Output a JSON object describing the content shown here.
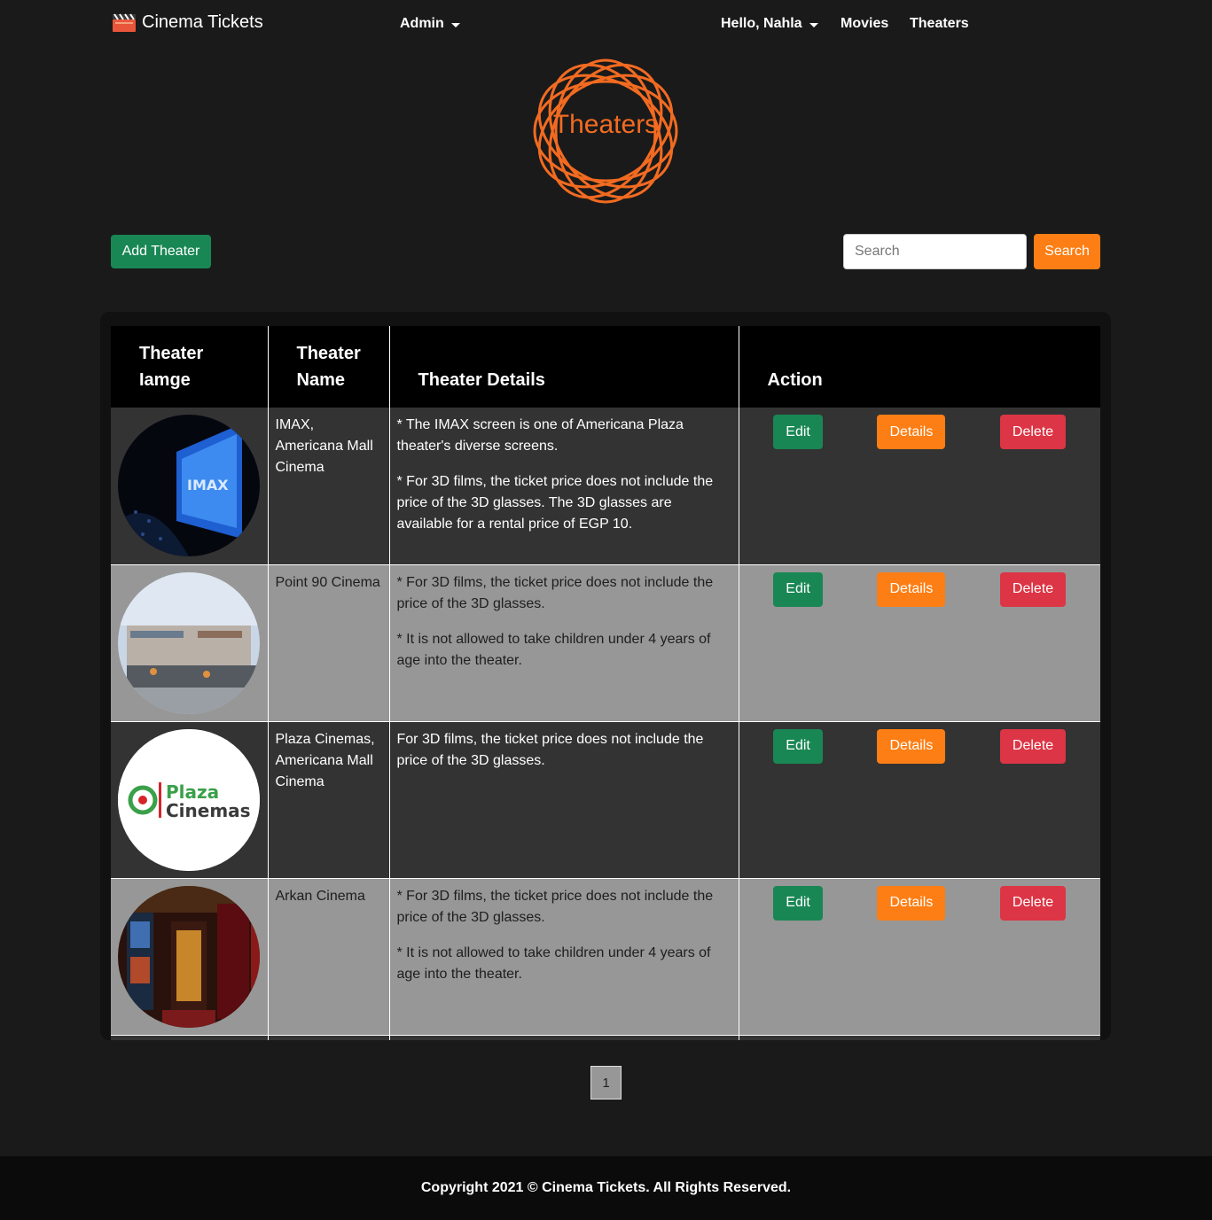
{
  "navbar": {
    "brand": "Cinema Tickets",
    "admin": "Admin",
    "greeting": "Hello, Nahla",
    "movies": "Movies",
    "theaters": "Theaters"
  },
  "logo": {
    "text": "Theaters",
    "color": "#f26b21"
  },
  "toolbar": {
    "add_label": "Add Theater",
    "search_placeholder": "Search",
    "search_label": "Search"
  },
  "table": {
    "headers": [
      "Theater Iamge",
      "Theater Name",
      "Theater Details",
      "Action"
    ],
    "header_image_line1": "Theater",
    "header_image_line2": "Iamge",
    "header_name_line1": "Theater",
    "header_name_line2": "Name",
    "actions": {
      "edit": "Edit",
      "details": "Details",
      "delete": "Delete"
    },
    "rows": [
      {
        "name": "IMAX, Americana Mall Cinema",
        "details": [
          "* The IMAX screen is one of Americana Plaza theater's diverse screens.",
          "* For 3D films, the ticket price does not include the price of the 3D glasses. The 3D glasses are available for a rental price of EGP 10."
        ],
        "image": "imax-screen"
      },
      {
        "name": "Point 90 Cinema",
        "details": [
          "* For 3D films, the ticket price does not include the price of the 3D glasses.",
          "* It is not allowed to take children under 4 years of age into the theater."
        ],
        "image": "point90-mall"
      },
      {
        "name": "Plaza Cinemas, Americana Mall Cinema",
        "details": [
          "For 3D films, the ticket price does not include the price of the 3D glasses."
        ],
        "image": "plaza-cinemas-logo",
        "logo_line1": "Plaza",
        "logo_line2": "Cinemas"
      },
      {
        "name": "Arkan Cinema",
        "details": [
          "* For 3D films, the ticket price does not include the price of the 3D glasses.",
          "* It is not allowed to take children under 4 years of age into the theater."
        ],
        "image": "arkan-lobby"
      }
    ]
  },
  "pagination": {
    "current": "1"
  },
  "footer": {
    "text": "Copyright 2021 © Cinema Tickets. All Rights Reserved."
  },
  "colors": {
    "green": "#198754",
    "orange": "#fd7e14",
    "red": "#dc3545"
  }
}
